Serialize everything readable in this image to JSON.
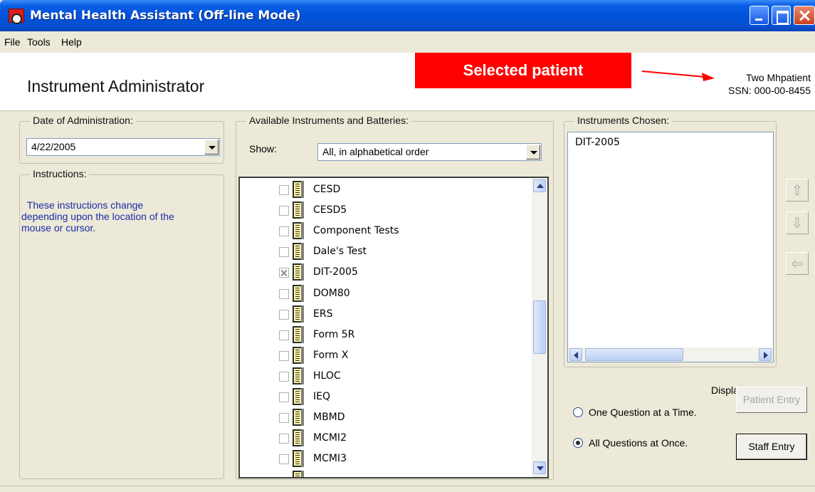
{
  "window": {
    "title": "Mental Health Assistant  (Off-line Mode)"
  },
  "menu": [
    "File",
    "Tools",
    "Help"
  ],
  "header": {
    "title": "Instrument Administrator",
    "callout": "Selected patient",
    "patient_name": "Two Mhpatient",
    "patient_ssn": "SSN: 000-00-8455"
  },
  "date_group": {
    "legend": "Date of Administration:",
    "value": "4/22/2005"
  },
  "instructions": {
    "legend": "Instructions:",
    "text": "  These instructions change\ndepending upon the location of the\nmouse or cursor."
  },
  "available": {
    "legend": "Available Instruments and Batteries:",
    "show_label": "Show:",
    "show_value": "All, in alphabetical order",
    "items": [
      {
        "label": "CESD",
        "checked": false
      },
      {
        "label": "CESD5",
        "checked": false
      },
      {
        "label": "Component Tests",
        "checked": false
      },
      {
        "label": "Dale's Test",
        "checked": false
      },
      {
        "label": "DIT-2005",
        "checked": true
      },
      {
        "label": "DOM80",
        "checked": false
      },
      {
        "label": "ERS",
        "checked": false
      },
      {
        "label": "Form 5R",
        "checked": false
      },
      {
        "label": "Form X",
        "checked": false
      },
      {
        "label": "HLOC",
        "checked": false
      },
      {
        "label": "IEQ",
        "checked": false
      },
      {
        "label": "MBMD",
        "checked": false
      },
      {
        "label": "MCMI2",
        "checked": false
      },
      {
        "label": "MCMI3",
        "checked": false
      }
    ]
  },
  "chosen": {
    "legend": "Instruments Chosen:",
    "items": [
      "DIT-2005"
    ]
  },
  "order_buttons": {
    "up": "⇧",
    "down": "⇩",
    "remove": "⇦"
  },
  "display": {
    "label": "Display:",
    "option_one": "One Question at a Time.",
    "option_all": "All Questions at Once.",
    "selected": "all"
  },
  "buttons": {
    "patient_entry": "Patient Entry",
    "staff_entry": "Staff Entry"
  },
  "colors": {
    "callout": "#ff0000",
    "titlebar": "#0054e3",
    "instructions_text": "#1b2ba8"
  },
  "icons": {
    "app": "app-logo-icon",
    "instrument": "document-list-icon",
    "arrow": "red-pointer-arrow"
  }
}
